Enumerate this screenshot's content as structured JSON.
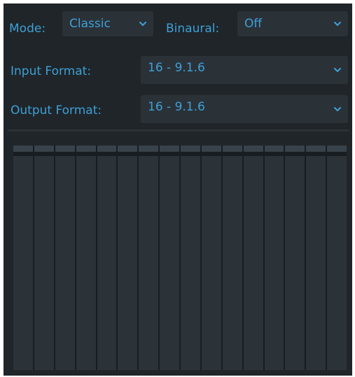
{
  "mode": {
    "label": "Mode:",
    "value": "Classic"
  },
  "binaural": {
    "label": "Binaural:",
    "value": "Off"
  },
  "input_format": {
    "label": "Input Format:",
    "value": "16 - 9.1.6"
  },
  "output_format": {
    "label": "Output Format:",
    "value": "16 - 9.1.6"
  },
  "meters": {
    "channel_count": 16
  },
  "colors": {
    "accent": "#3f9fd6",
    "panel_bg": "#1f2529",
    "dropdown_bg": "#2a3238",
    "meter_bg": "#2b3339",
    "meter_cap": "#38424a"
  },
  "icons": {
    "dropdown": "chevron-down-icon"
  }
}
